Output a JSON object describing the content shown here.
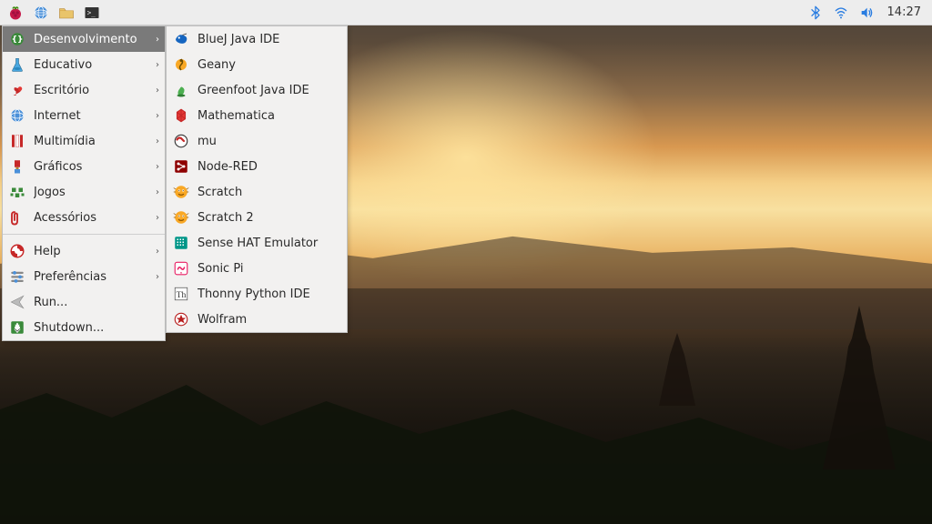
{
  "clock": "14:27",
  "taskbar": {
    "launchers": [
      {
        "name": "menu-raspberry",
        "icon": "raspberry"
      },
      {
        "name": "browser-chromium",
        "icon": "globe"
      },
      {
        "name": "file-manager",
        "icon": "folder"
      },
      {
        "name": "terminal",
        "icon": "terminal"
      }
    ],
    "tray": [
      {
        "name": "bluetooth",
        "icon": "bluetooth"
      },
      {
        "name": "network-wifi",
        "icon": "wifi"
      },
      {
        "name": "volume",
        "icon": "volume"
      }
    ]
  },
  "menu": {
    "categories": [
      {
        "label": "Desenvolvimento",
        "icon": "dev",
        "submenu": true,
        "selected": true
      },
      {
        "label": "Educativo",
        "icon": "flask",
        "submenu": true
      },
      {
        "label": "Escritório",
        "icon": "lamp",
        "submenu": true
      },
      {
        "label": "Internet",
        "icon": "globe",
        "submenu": true
      },
      {
        "label": "Multimídia",
        "icon": "multimedia",
        "submenu": true
      },
      {
        "label": "Gráficos",
        "icon": "brush",
        "submenu": true
      },
      {
        "label": "Jogos",
        "icon": "games",
        "submenu": true
      },
      {
        "label": "Acessórios",
        "icon": "clip",
        "submenu": true
      }
    ],
    "utilities": [
      {
        "label": "Help",
        "icon": "help",
        "submenu": true
      },
      {
        "label": "Preferências",
        "icon": "prefs",
        "submenu": true
      },
      {
        "label": "Run...",
        "icon": "run"
      },
      {
        "label": "Shutdown...",
        "icon": "shutdown"
      }
    ]
  },
  "submenu": {
    "items": [
      {
        "label": "BlueJ Java IDE",
        "icon": "bluej"
      },
      {
        "label": "Geany",
        "icon": "geany"
      },
      {
        "label": "Greenfoot Java IDE",
        "icon": "greenfoot"
      },
      {
        "label": "Mathematica",
        "icon": "mathematica"
      },
      {
        "label": "mu",
        "icon": "mu"
      },
      {
        "label": "Node-RED",
        "icon": "nodered"
      },
      {
        "label": "Scratch",
        "icon": "scratch"
      },
      {
        "label": "Scratch 2",
        "icon": "scratch"
      },
      {
        "label": "Sense HAT Emulator",
        "icon": "sensehat"
      },
      {
        "label": "Sonic Pi",
        "icon": "sonicpi"
      },
      {
        "label": "Thonny Python IDE",
        "icon": "thonny"
      },
      {
        "label": "Wolfram",
        "icon": "wolfram"
      }
    ]
  }
}
